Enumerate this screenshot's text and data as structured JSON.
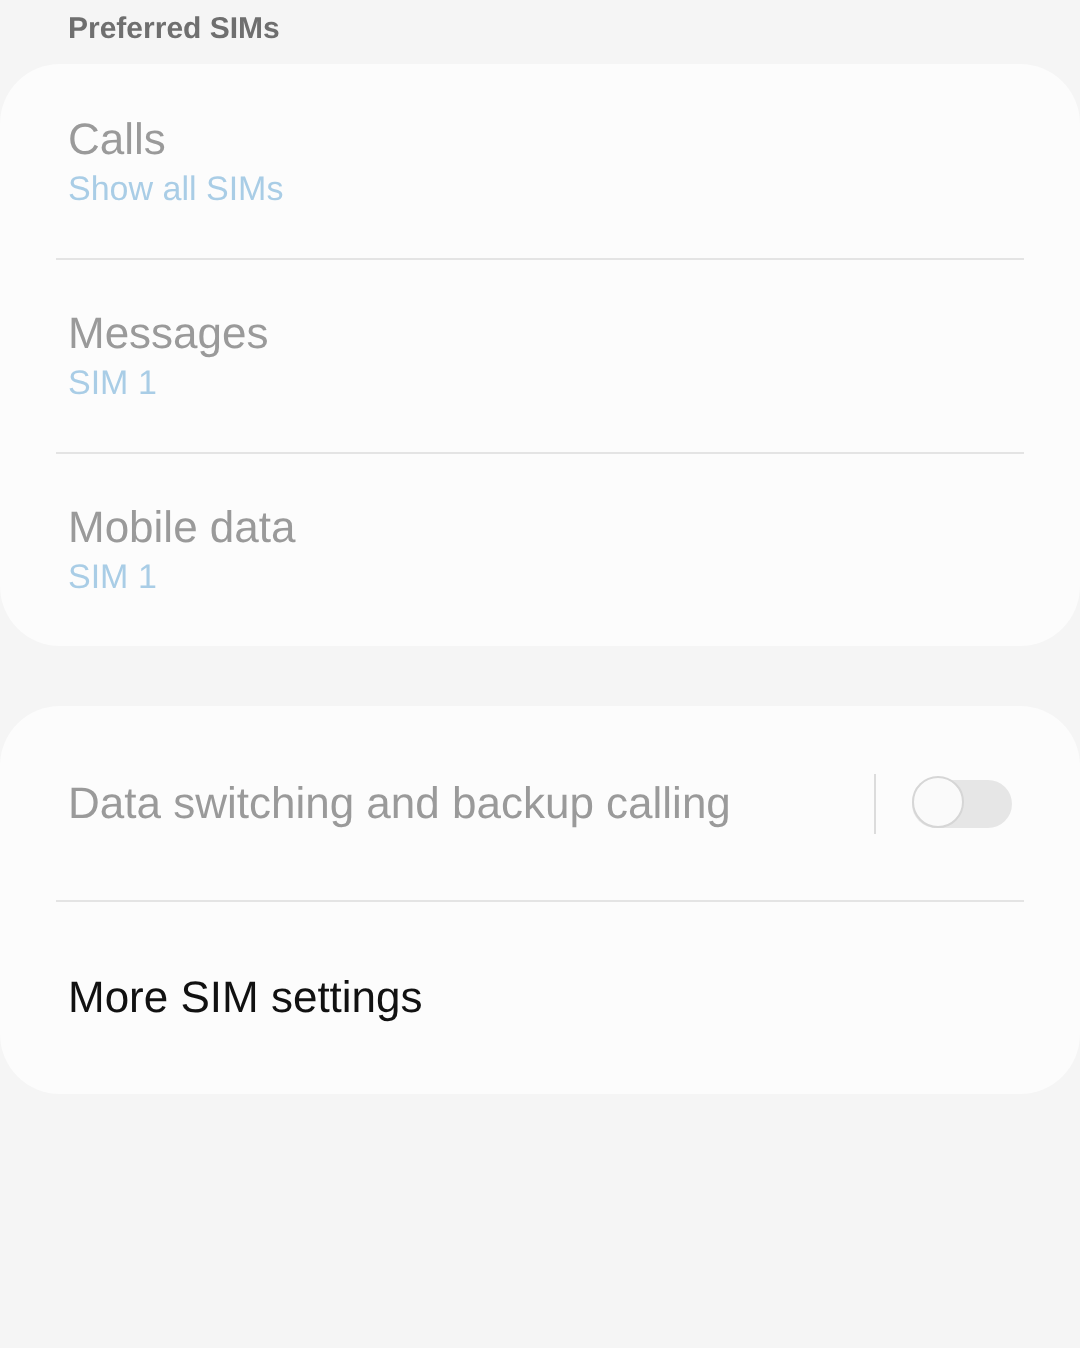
{
  "sections": [
    {
      "header": "Preferred SIMs",
      "items": [
        {
          "kind": "choice",
          "title": "Calls",
          "value": "Show all SIMs",
          "disabled": true
        },
        {
          "kind": "choice",
          "title": "Messages",
          "value": "SIM 1",
          "disabled": true
        },
        {
          "kind": "choice",
          "title": "Mobile data",
          "value": "SIM 1",
          "disabled": true
        }
      ]
    },
    {
      "items": [
        {
          "kind": "switch",
          "title": "Data switching and backup calling",
          "on": false,
          "disabled": true
        },
        {
          "kind": "link",
          "title": "More SIM settings",
          "disabled": false
        }
      ]
    }
  ]
}
